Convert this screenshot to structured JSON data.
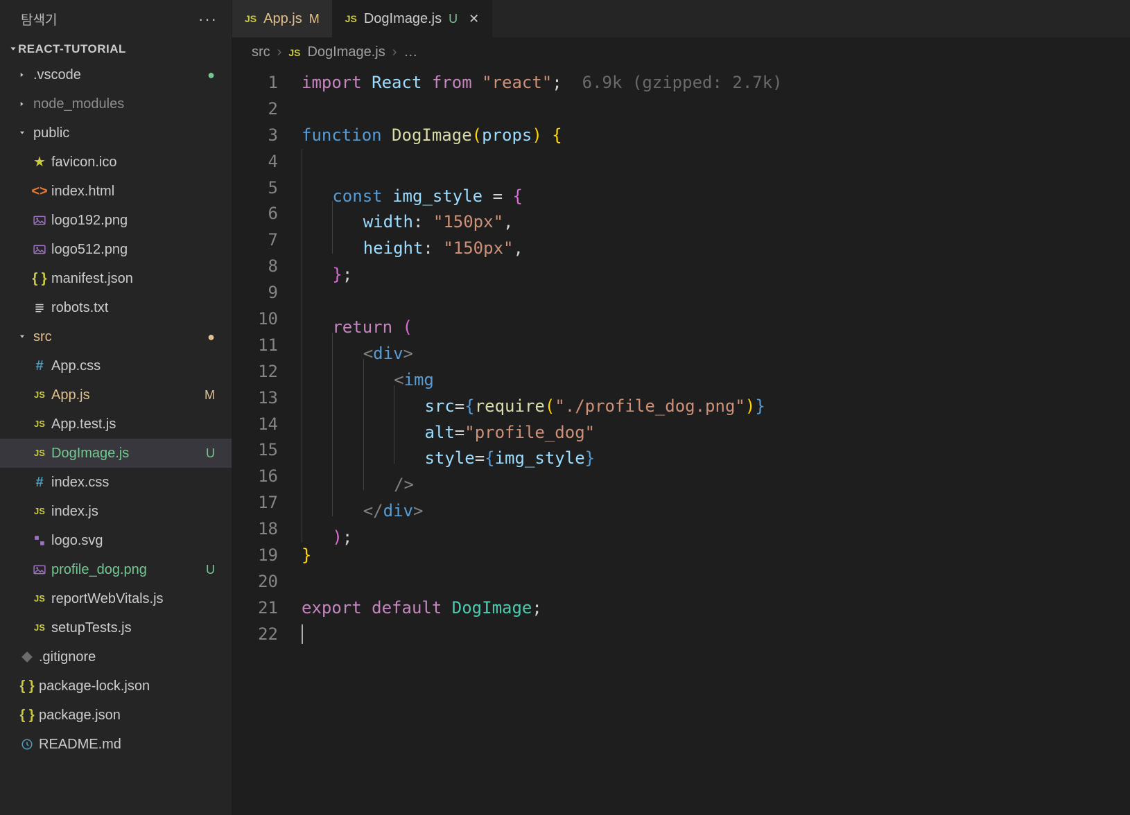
{
  "sidebar": {
    "title": "탐색기",
    "project": "REACT-TUTORIAL",
    "items": [
      {
        "type": "folder",
        "label": ".vscode",
        "depth": 1,
        "open": false,
        "status": "dot-unt"
      },
      {
        "type": "folder",
        "label": "node_modules",
        "depth": 1,
        "open": false,
        "dim": true
      },
      {
        "type": "folder",
        "label": "public",
        "depth": 1,
        "open": true
      },
      {
        "type": "file",
        "label": "favicon.ico",
        "depth": 2,
        "icon": "star"
      },
      {
        "type": "file",
        "label": "index.html",
        "depth": 2,
        "icon": "html"
      },
      {
        "type": "file",
        "label": "logo192.png",
        "depth": 2,
        "icon": "img"
      },
      {
        "type": "file",
        "label": "logo512.png",
        "depth": 2,
        "icon": "img"
      },
      {
        "type": "file",
        "label": "manifest.json",
        "depth": 2,
        "icon": "json"
      },
      {
        "type": "file",
        "label": "robots.txt",
        "depth": 2,
        "icon": "txt"
      },
      {
        "type": "folder",
        "label": "src",
        "depth": 1,
        "open": true,
        "modified": true,
        "status": "dot-mod"
      },
      {
        "type": "file",
        "label": "App.css",
        "depth": 2,
        "icon": "css"
      },
      {
        "type": "file",
        "label": "App.js",
        "depth": 2,
        "icon": "js",
        "modified": true,
        "statusLetter": "M"
      },
      {
        "type": "file",
        "label": "App.test.js",
        "depth": 2,
        "icon": "js"
      },
      {
        "type": "file",
        "label": "DogImage.js",
        "depth": 2,
        "icon": "js",
        "untracked": true,
        "statusLetter": "U",
        "active": true
      },
      {
        "type": "file",
        "label": "index.css",
        "depth": 2,
        "icon": "css"
      },
      {
        "type": "file",
        "label": "index.js",
        "depth": 2,
        "icon": "js"
      },
      {
        "type": "file",
        "label": "logo.svg",
        "depth": 2,
        "icon": "svg"
      },
      {
        "type": "file",
        "label": "profile_dog.png",
        "depth": 2,
        "icon": "img",
        "untracked": true,
        "statusLetter": "U"
      },
      {
        "type": "file",
        "label": "reportWebVitals.js",
        "depth": 2,
        "icon": "js"
      },
      {
        "type": "file",
        "label": "setupTests.js",
        "depth": 2,
        "icon": "js"
      },
      {
        "type": "file",
        "label": ".gitignore",
        "depth": 1,
        "icon": "git"
      },
      {
        "type": "file",
        "label": "package-lock.json",
        "depth": 1,
        "icon": "json"
      },
      {
        "type": "file",
        "label": "package.json",
        "depth": 1,
        "icon": "json"
      },
      {
        "type": "file",
        "label": "README.md",
        "depth": 1,
        "icon": "md"
      }
    ]
  },
  "tabs": [
    {
      "label": "App.js",
      "status": "M",
      "modified": true
    },
    {
      "label": "DogImage.js",
      "status": "U",
      "untracked": true,
      "active": true,
      "closeable": true
    }
  ],
  "breadcrumb": {
    "root": "src",
    "file": "DogImage.js",
    "tail": "…"
  },
  "code": {
    "hint": "6.9k (gzipped: 2.7k)",
    "lines": 22,
    "content": {
      "l1_import": "import",
      "l1_react": "React",
      "l1_from": "from",
      "l1_str": "\"react\"",
      "l3_function": "function",
      "l3_name": "DogImage",
      "l3_props": "props",
      "l5_const": "const",
      "l5_var": "img_style",
      "l6_key": "width",
      "l6_val": "\"150px\"",
      "l7_key": "height",
      "l7_val": "\"150px\"",
      "l10_return": "return",
      "l11_div": "div",
      "l12_img": "img",
      "l13_attr": "src",
      "l13_require": "require",
      "l13_path": "\"./profile_dog.png\"",
      "l14_attr": "alt",
      "l14_val": "\"profile_dog\"",
      "l15_attr": "style",
      "l15_val": "img_style",
      "l17_div": "div",
      "l21_export": "export",
      "l21_default": "default",
      "l21_name": "DogImage"
    }
  }
}
